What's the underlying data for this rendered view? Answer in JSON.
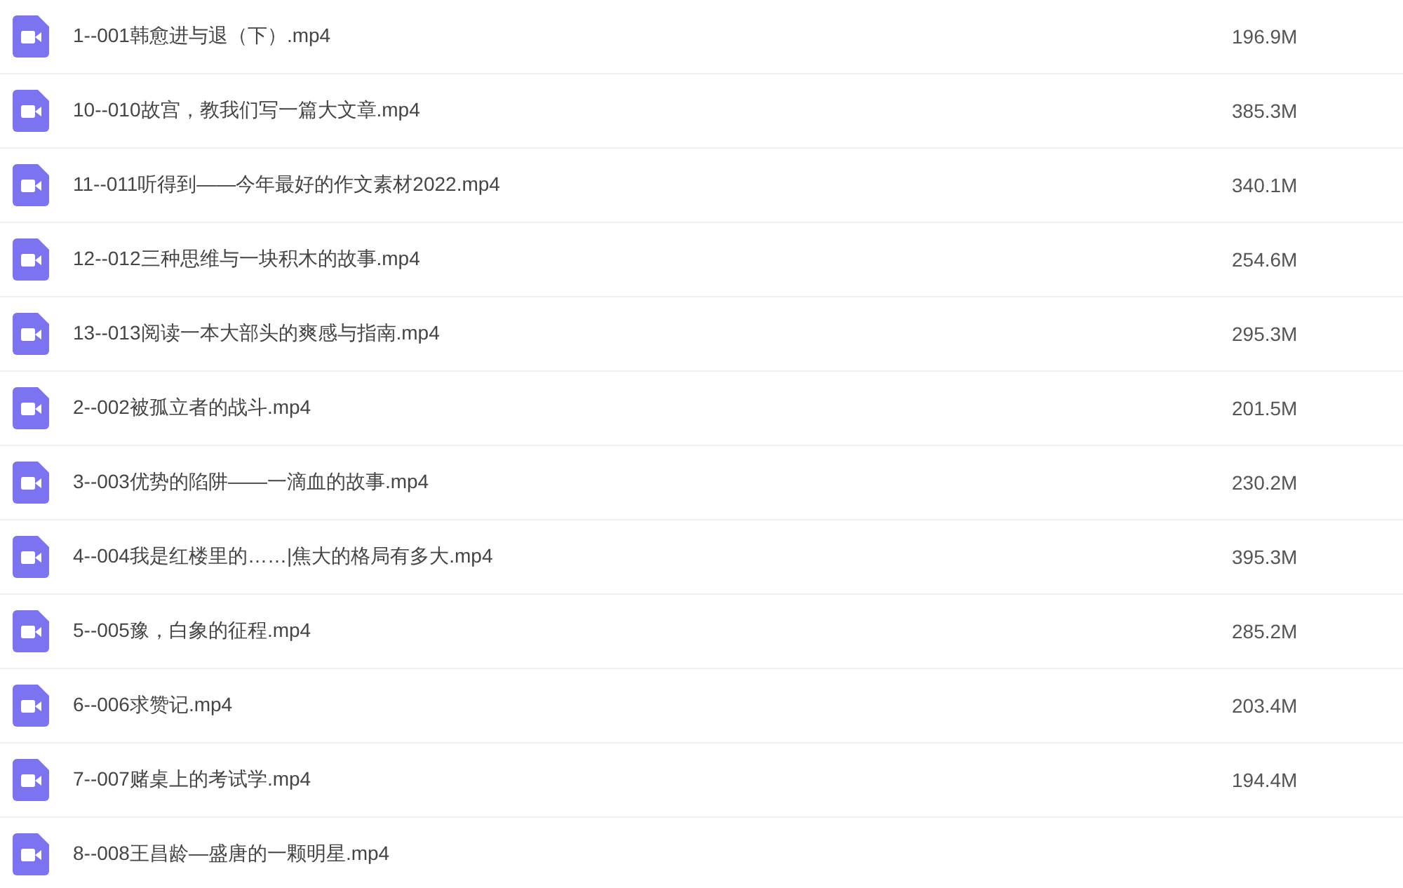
{
  "files": [
    {
      "name": "1--001韩愈进与退（下）.mp4",
      "size": "196.9M"
    },
    {
      "name": "10--010故宫，教我们写一篇大文章.mp4",
      "size": "385.3M"
    },
    {
      "name": "11--011听得到——今年最好的作文素材2022.mp4",
      "size": "340.1M"
    },
    {
      "name": "12--012三种思维与一块积木的故事.mp4",
      "size": "254.6M"
    },
    {
      "name": "13--013阅读一本大部头的爽感与指南.mp4",
      "size": "295.3M"
    },
    {
      "name": "2--002被孤立者的战斗.mp4",
      "size": "201.5M"
    },
    {
      "name": "3--003优势的陷阱——一滴血的故事.mp4",
      "size": "230.2M"
    },
    {
      "name": "4--004我是红楼里的……|焦大的格局有多大.mp4",
      "size": "395.3M"
    },
    {
      "name": "5--005豫，白象的征程.mp4",
      "size": "285.2M"
    },
    {
      "name": "6--006求赞记.mp4",
      "size": "203.4M"
    },
    {
      "name": "7--007赌桌上的考试学.mp4",
      "size": "194.4M"
    },
    {
      "name": "8--008王昌龄—盛唐的一颗明星.mp4"
    }
  ]
}
